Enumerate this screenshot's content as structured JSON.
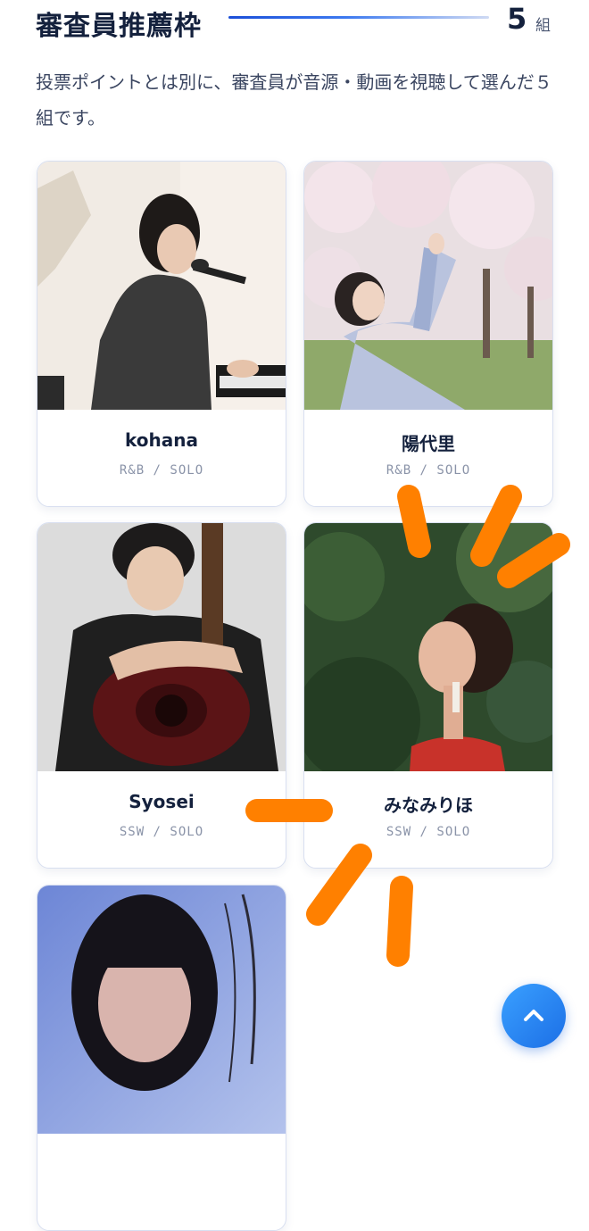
{
  "section": {
    "title": "審査員推薦枠",
    "count": "5",
    "count_unit": "組",
    "description": "投票ポイントとは別に、審査員が音源・動画を視聴して選んだ５組です。"
  },
  "cards": [
    {
      "name": "kohana",
      "genre": "R&B / SOLO"
    },
    {
      "name": "陽代里",
      "genre": "R&B / SOLO"
    },
    {
      "name": "Syosei",
      "genre": "SSW / SOLO"
    },
    {
      "name": "みなみりほ",
      "genre": "SSW / SOLO"
    },
    {
      "name": "",
      "genre": ""
    }
  ],
  "colors": {
    "accent": "#1b4fd8",
    "heading": "#14213d",
    "scroll_button": "#1c6fe6",
    "highlight_strokes": "#ff8000"
  },
  "icons": {
    "scroll_top": "chevron-up-icon"
  }
}
